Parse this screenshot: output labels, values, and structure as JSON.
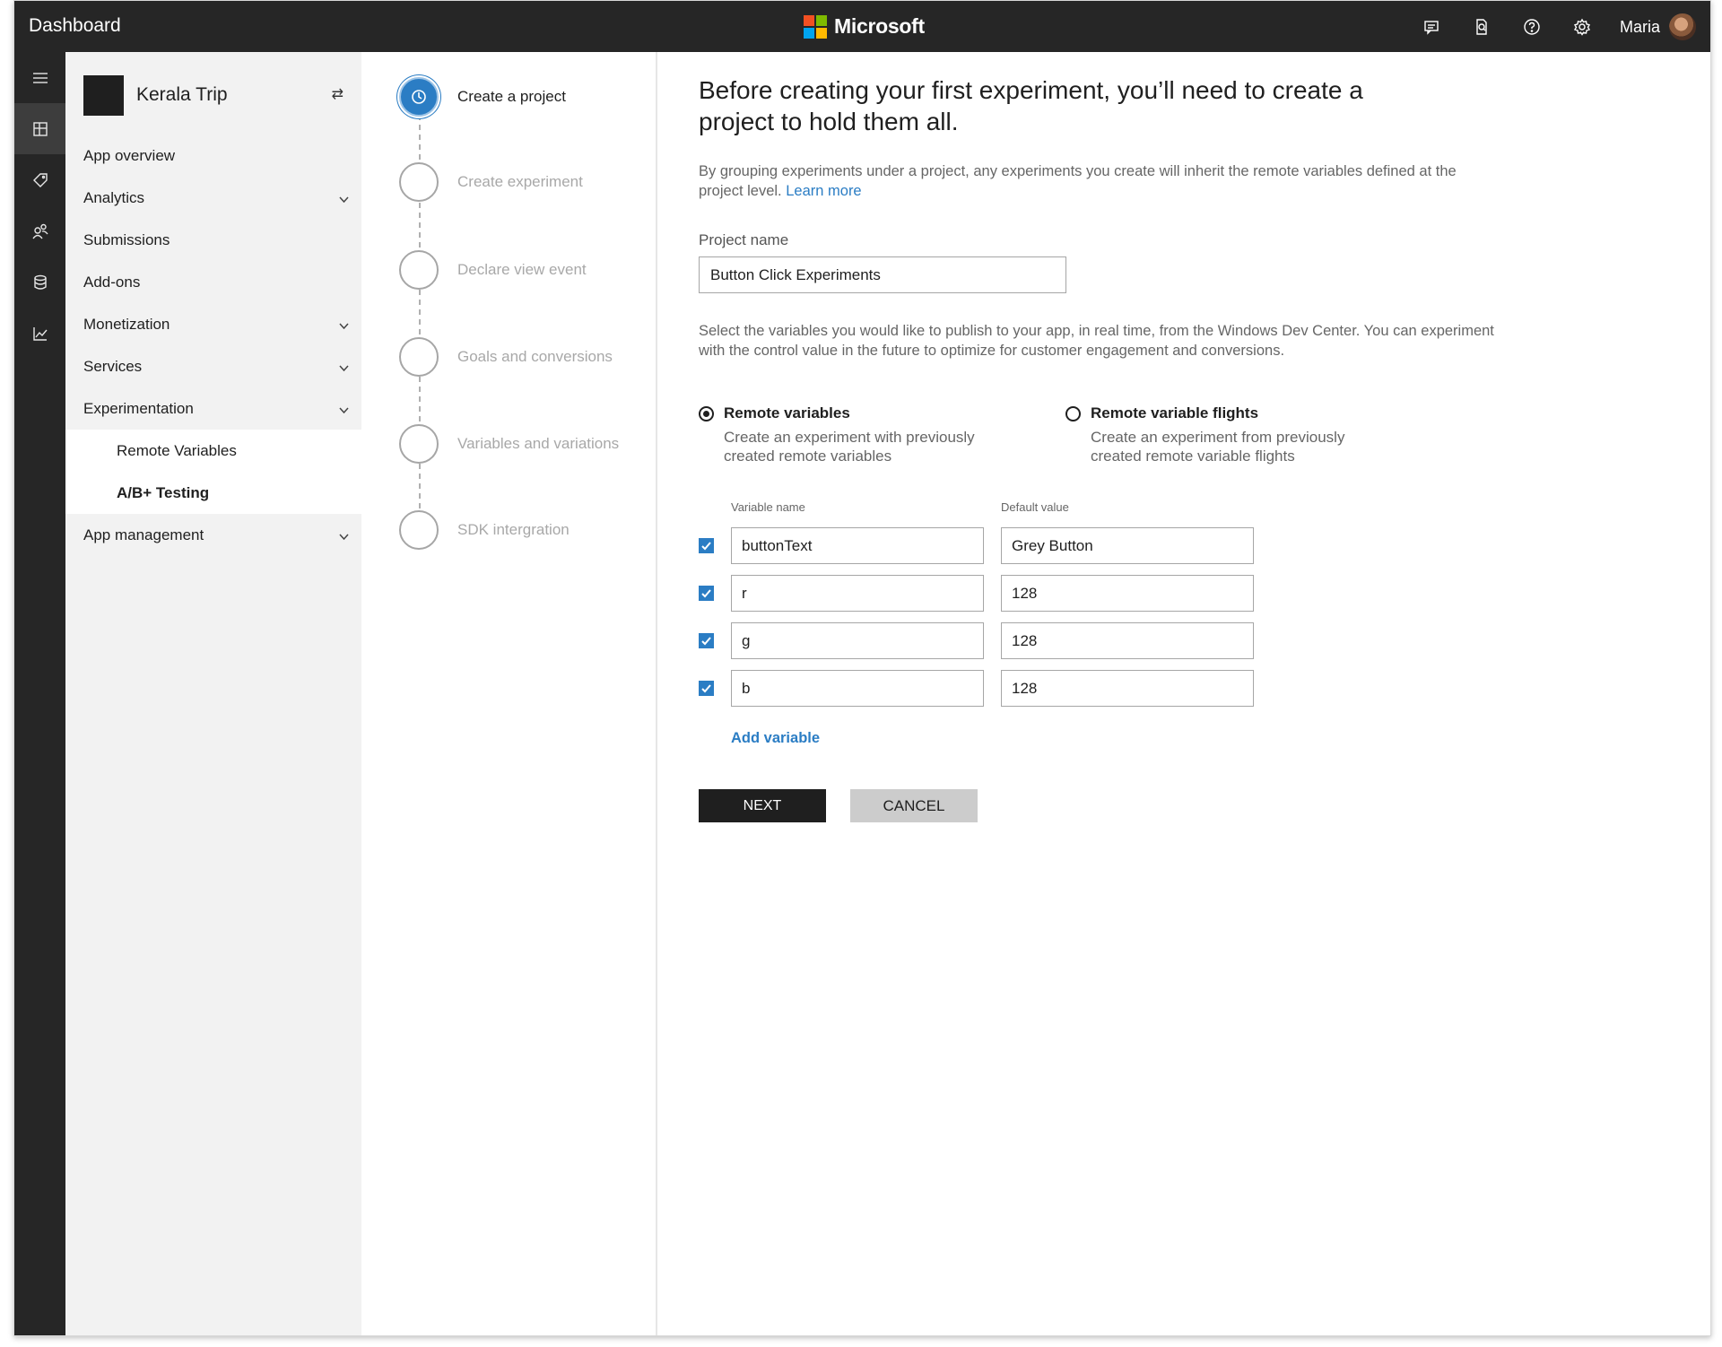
{
  "topbar": {
    "title": "Dashboard",
    "brand": "Microsoft",
    "brand_colors": [
      "#f25022",
      "#7fba00",
      "#00a4ef",
      "#ffb900"
    ],
    "icons": [
      "feedback-icon",
      "document-search-icon",
      "help-icon",
      "settings-icon"
    ],
    "user_name": "Maria"
  },
  "rail": {
    "icons": [
      "hamburger-menu-icon",
      "dashboard-icon",
      "tag-icon",
      "users-icon",
      "database-icon",
      "chart-icon"
    ],
    "active_index": 1
  },
  "nav": {
    "app_name": "Kerala Trip",
    "items": [
      {
        "label": "App overview"
      },
      {
        "label": "Analytics",
        "expandable": true
      },
      {
        "label": "Submissions"
      },
      {
        "label": "Add-ons"
      },
      {
        "label": "Monetization",
        "expandable": true
      },
      {
        "label": "Services",
        "expandable": true
      },
      {
        "label": "Experimentation",
        "expandable": true
      },
      {
        "label": "App management",
        "expandable": true
      }
    ],
    "sub_items": [
      {
        "label": "Remote Variables"
      },
      {
        "label": "A/B+ Testing",
        "selected": true
      }
    ]
  },
  "steps": [
    {
      "label": "Create a project",
      "active": true
    },
    {
      "label": "Create experiment"
    },
    {
      "label": "Declare view event"
    },
    {
      "label": "Goals and conversions"
    },
    {
      "label": "Variables and variations"
    },
    {
      "label": "SDK intergration"
    }
  ],
  "main": {
    "heading": "Before creating your first experiment, you’ll need to create a project to hold them all.",
    "description": "By grouping experiments under a project, any experiments you create will inherit the remote variables defined at the project level.",
    "learn_more": "Learn more",
    "project_name_label": "Project name",
    "project_name_value": "Button Click Experiments",
    "variables_description": "Select the variables you would like to publish to your app, in real time, from the Windows Dev Center. You can experiment with the control value in the future to optimize for customer engagement and conversions.",
    "radio_options": [
      {
        "title": "Remote variables",
        "desc": "Create an experiment with previously created remote variables",
        "selected": true
      },
      {
        "title": "Remote variable flights",
        "desc": "Create an experiment from previously created remote variable flights",
        "selected": false
      }
    ],
    "col_variable_name": "Variable name",
    "col_default_value": "Default value",
    "variables": [
      {
        "name": "buttonText",
        "value": "Grey Button",
        "checked": true
      },
      {
        "name": "r",
        "value": "128",
        "checked": true
      },
      {
        "name": "g",
        "value": "128",
        "checked": true
      },
      {
        "name": "b",
        "value": "128",
        "checked": true
      }
    ],
    "add_variable": "Add variable",
    "next_label": "NEXT",
    "cancel_label": "CANCEL"
  },
  "colors": {
    "accent": "#2b7dc4",
    "topbar": "#262626",
    "nav_bg": "#f2f2f2"
  }
}
